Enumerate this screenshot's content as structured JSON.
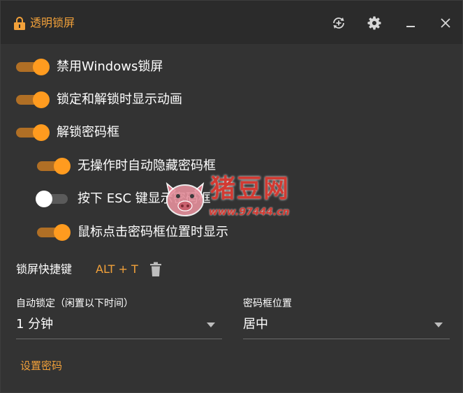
{
  "window": {
    "title": "透明锁屏",
    "controls": {
      "sync_icon": "sync-icon",
      "settings_icon": "gear-icon",
      "minimize_icon": "minimize-icon",
      "close_icon": "close-icon"
    }
  },
  "options": [
    {
      "label": "禁用Windows锁屏",
      "on": true
    },
    {
      "label": "锁定和解锁时显示动画",
      "on": true
    },
    {
      "label": "解锁密码框",
      "on": true
    },
    {
      "label": "无操作时自动隐藏密码框",
      "on": true
    },
    {
      "label": "按下 ESC 键显示密码框",
      "on": false
    },
    {
      "label": "鼠标点击密码框位置时显示",
      "on": true
    }
  ],
  "shortcut": {
    "label": "锁屏快捷键",
    "value": "ALT + T",
    "delete_icon": "trash-icon"
  },
  "auto_lock": {
    "label": "自动锁定（闲置以下时间）",
    "value": "1 分钟"
  },
  "password_position": {
    "label": "密码框位置",
    "value": "居中"
  },
  "set_password_label": "设置密码",
  "watermark": {
    "text": "猪豆网",
    "url": "www.97444.cn"
  },
  "colors": {
    "accent": "#f2a13a",
    "toggle_thumb": "#ff9b1f",
    "toggle_track": "#b06f25",
    "background": "#333333",
    "titlebar": "#2b2b2b"
  }
}
